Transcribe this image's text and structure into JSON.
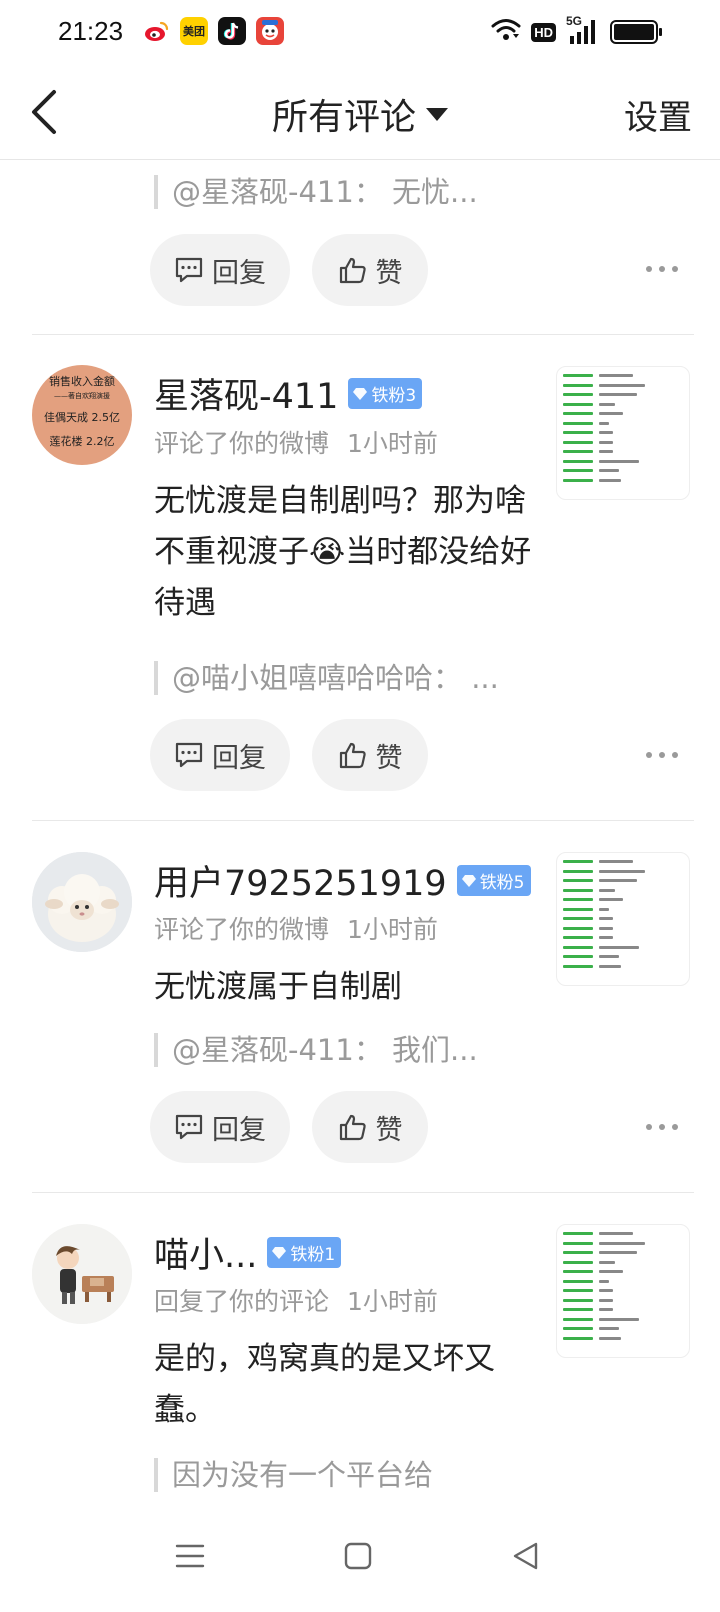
{
  "status_bar": {
    "time": "21:23",
    "apps": [
      "weibo-icon",
      "meituan-icon",
      "douyin-icon",
      "game-icon"
    ],
    "meituan_label": "美团",
    "hd_label": "HD",
    "network": "5G",
    "wifi": "wifi-icon",
    "battery": "battery-icon",
    "battery_level": 1.0
  },
  "header": {
    "title": "所有评论",
    "settings_label": "设置"
  },
  "comments": [
    {
      "quote": "@星落砚-411：  无忧...",
      "reply_label": "回复",
      "like_label": "赞"
    },
    {
      "name": "星落砚-411",
      "badge": "铁粉3",
      "action": "评论了你的微博",
      "time": "1小时前",
      "text_before_emoji": "无忧渡是自制剧吗？那为啥不重视渡子",
      "emoji": "😭",
      "text_after_emoji": "当时都没给好待遇",
      "quote": "@喵小姐嘻嘻哈哈哈：  ...",
      "reply_label": "回复",
      "like_label": "赞",
      "avatar_lines": [
        "销售收入金额",
        "——著自欢翔演援",
        "佳偶天成  2.5亿",
        "莲花楼  2.2亿"
      ],
      "avatar_color": "#e3a07f"
    },
    {
      "name": "用户7925251919",
      "badge": "铁粉5",
      "action": "评论了你的微博",
      "time": "1小时前",
      "text": "无忧渡属于自制剧",
      "quote": "@星落砚-411：  我们...",
      "reply_label": "回复",
      "like_label": "赞"
    },
    {
      "name": "喵小...",
      "badge": "铁粉1",
      "action": "回复了你的评论",
      "time": "1小时前",
      "text": "是的，鸡窝真的是又坏又蠢。",
      "quote": "因为没有一个平台给"
    }
  ],
  "colors": {
    "badge": "#6aa6f5",
    "text_primary": "#222222",
    "text_secondary": "#9a9a9a",
    "button_bg": "#f2f2f2"
  }
}
